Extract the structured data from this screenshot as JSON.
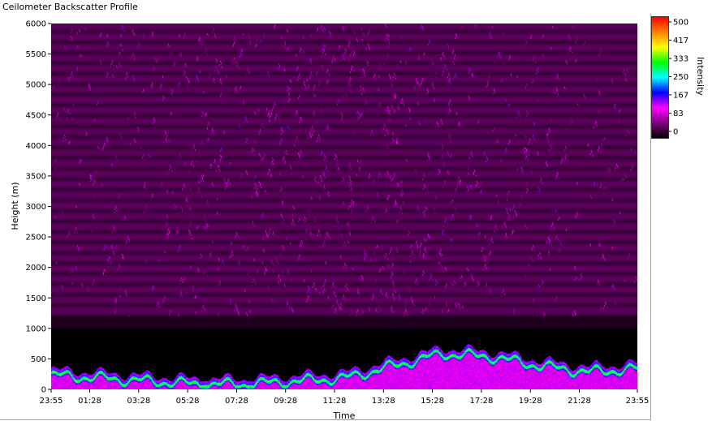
{
  "window": {
    "title": "Ceilometer Backscatter Profile"
  },
  "chart_data": {
    "type": "heatmap",
    "title": "Ceilometer Backscatter Profile",
    "xlabel": "Time",
    "ylabel": "Height (m)",
    "x_ticks": [
      "23:55",
      "01:28",
      "03:28",
      "05:28",
      "07:28",
      "09:28",
      "11:28",
      "13:28",
      "15:28",
      "17:28",
      "19:28",
      "21:28",
      "23:55"
    ],
    "y_ticks": [
      0,
      500,
      1000,
      1500,
      2000,
      2500,
      3000,
      3500,
      4000,
      4500,
      5000,
      5500,
      6000
    ],
    "ylim": [
      0,
      6000
    ],
    "xlim": [
      "23:55",
      "23:55"
    ],
    "grid": false,
    "colorbar": {
      "label": "Intensity",
      "range": [
        0,
        500
      ],
      "ticks": [
        500,
        417,
        333,
        250,
        167,
        83,
        0
      ],
      "colors": [
        "#000000",
        "#800080",
        "#ff00ff",
        "#0000ff",
        "#00ffff",
        "#00ff00",
        "#ffff00",
        "#ff8000",
        "#ff0000"
      ]
    },
    "layer_top_profile": {
      "times": [
        "23:55",
        "01:28",
        "03:28",
        "05:28",
        "07:28",
        "09:28",
        "11:28",
        "13:28",
        "15:28",
        "17:28",
        "19:28",
        "21:28",
        "23:55"
      ],
      "height_m": [
        250,
        200,
        150,
        100,
        100,
        150,
        200,
        400,
        600,
        550,
        400,
        300,
        350
      ]
    }
  }
}
